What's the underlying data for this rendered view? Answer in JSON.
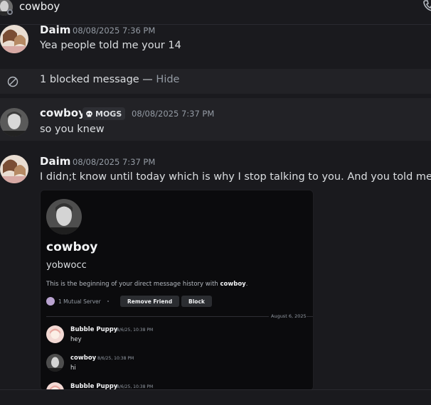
{
  "header": {
    "title": "cowboy",
    "icons": {
      "call": "phone-icon",
      "status": "offline-status-icon"
    }
  },
  "messages": [
    {
      "author": "Daim",
      "timestamp": "08/08/2025 7:36 PM",
      "text": "Yea people told me your 14"
    },
    {
      "blocked_text": "1 blocked message — ",
      "blocked_action": "Hide",
      "icon": "blocked-icon"
    },
    {
      "author": "cowboy",
      "badge": "MOGS",
      "badge_icon": "skull-icon",
      "timestamp": "08/08/2025 7:37 PM",
      "text": "so you knew"
    },
    {
      "author": "Daim",
      "timestamp": "08/08/2025 7:37 PM",
      "text": "I didn;t know until today which is why I stop talking to you. And you told me"
    }
  ],
  "attachment": {
    "profile_name": "cowboy",
    "profile_username": "yobwocc",
    "beginning_text": "This is the beginning of your direct message history with ",
    "beginning_name": "cowboy",
    "beginning_end": ".",
    "mutual_servers": "1 Mutual Server",
    "remove_friend": "Remove Friend",
    "block": "Block",
    "divider_date": "August 6, 2025",
    "messages": [
      {
        "author": "Bubble Puppy",
        "timestamp": "8/6/25, 10:38 PM",
        "text": "hey"
      },
      {
        "author": "cowboy",
        "timestamp": "8/6/25, 10:38 PM",
        "text": "hi"
      },
      {
        "author": "Bubble Puppy",
        "timestamp": "8/6/25, 10:38 PM",
        "text": ""
      }
    ]
  },
  "colors": {
    "background": "#1a1a1e",
    "hover_row": "#222226",
    "text": "#dbdee1",
    "muted": "#949ba4"
  }
}
